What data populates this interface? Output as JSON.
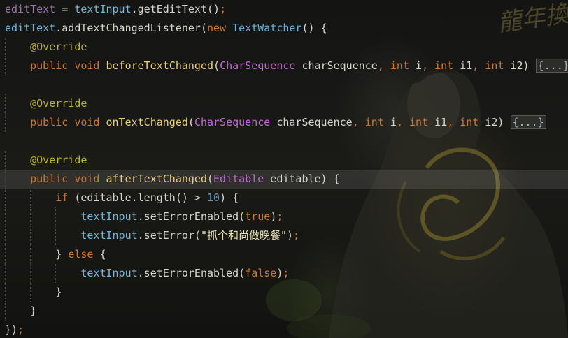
{
  "editor": {
    "lines": [
      {
        "tokens": [
          {
            "t": "editText",
            "c": "field"
          },
          {
            "t": " = ",
            "c": "plain"
          },
          {
            "t": "textInput",
            "c": "fieldcyan"
          },
          {
            "t": ".getEditText()",
            "c": "plain"
          },
          {
            "t": ";",
            "c": "semi"
          }
        ]
      },
      {
        "tokens": [
          {
            "t": "editText",
            "c": "fieldcyan"
          },
          {
            "t": ".addTextChangedListener(",
            "c": "plain"
          },
          {
            "t": "new",
            "c": "kw"
          },
          {
            "t": " ",
            "c": "plain"
          },
          {
            "t": "TextWatcher",
            "c": "cls"
          },
          {
            "t": "() {",
            "c": "plain"
          }
        ]
      },
      {
        "tokens": [
          {
            "t": "    ",
            "c": "plain"
          },
          {
            "t": "@Override",
            "c": "ann"
          }
        ]
      },
      {
        "tokens": [
          {
            "t": "    ",
            "c": "plain"
          },
          {
            "t": "public",
            "c": "kw"
          },
          {
            "t": " ",
            "c": "plain"
          },
          {
            "t": "void",
            "c": "kw"
          },
          {
            "t": " ",
            "c": "plain"
          },
          {
            "t": "beforeTextChanged",
            "c": "method"
          },
          {
            "t": "(",
            "c": "plain"
          },
          {
            "t": "CharSequence",
            "c": "type"
          },
          {
            "t": " charSequence",
            "c": "plain"
          },
          {
            "t": ", ",
            "c": "semi"
          },
          {
            "t": "int",
            "c": "kw"
          },
          {
            "t": " i",
            "c": "plain"
          },
          {
            "t": ", ",
            "c": "semi"
          },
          {
            "t": "int",
            "c": "kw"
          },
          {
            "t": " i1",
            "c": "plain"
          },
          {
            "t": ", ",
            "c": "semi"
          },
          {
            "t": "int",
            "c": "kw"
          },
          {
            "t": " i2) ",
            "c": "plain"
          },
          {
            "t": "{...}",
            "c": "fold"
          }
        ]
      },
      {
        "tokens": []
      },
      {
        "tokens": [
          {
            "t": "    ",
            "c": "plain"
          },
          {
            "t": "@Override",
            "c": "ann"
          }
        ]
      },
      {
        "tokens": [
          {
            "t": "    ",
            "c": "plain"
          },
          {
            "t": "public",
            "c": "kw"
          },
          {
            "t": " ",
            "c": "plain"
          },
          {
            "t": "void",
            "c": "kw"
          },
          {
            "t": " ",
            "c": "plain"
          },
          {
            "t": "onTextChanged",
            "c": "method"
          },
          {
            "t": "(",
            "c": "plain"
          },
          {
            "t": "CharSequence",
            "c": "type"
          },
          {
            "t": " charSequence",
            "c": "plain"
          },
          {
            "t": ", ",
            "c": "semi"
          },
          {
            "t": "int",
            "c": "kw"
          },
          {
            "t": " i",
            "c": "plain"
          },
          {
            "t": ", ",
            "c": "semi"
          },
          {
            "t": "int",
            "c": "kw"
          },
          {
            "t": " i1",
            "c": "plain"
          },
          {
            "t": ", ",
            "c": "semi"
          },
          {
            "t": "int",
            "c": "kw"
          },
          {
            "t": " i2) ",
            "c": "plain"
          },
          {
            "t": "{...}",
            "c": "fold"
          }
        ]
      },
      {
        "tokens": []
      },
      {
        "tokens": [
          {
            "t": "    ",
            "c": "plain"
          },
          {
            "t": "@Override",
            "c": "ann"
          }
        ]
      },
      {
        "current": true,
        "tokens": [
          {
            "t": "    ",
            "c": "plain"
          },
          {
            "t": "public",
            "c": "kw"
          },
          {
            "t": " ",
            "c": "plain"
          },
          {
            "t": "void",
            "c": "kw"
          },
          {
            "t": " ",
            "c": "plain"
          },
          {
            "t": "afterTextChanged",
            "c": "method"
          },
          {
            "t": "(",
            "c": "plain"
          },
          {
            "t": "Editable",
            "c": "type"
          },
          {
            "t": " editable) {",
            "c": "plain"
          }
        ]
      },
      {
        "tokens": [
          {
            "t": "        ",
            "c": "plain"
          },
          {
            "t": "if",
            "c": "kw"
          },
          {
            "t": " (editable.length() > ",
            "c": "plain"
          },
          {
            "t": "10",
            "c": "num"
          },
          {
            "t": ") {",
            "c": "plain"
          }
        ]
      },
      {
        "tokens": [
          {
            "t": "            ",
            "c": "plain"
          },
          {
            "t": "textInput",
            "c": "fieldcyan"
          },
          {
            "t": ".setErrorEnabled(",
            "c": "plain"
          },
          {
            "t": "true",
            "c": "kw"
          },
          {
            "t": ")",
            "c": "plain"
          },
          {
            "t": ";",
            "c": "semi"
          }
        ]
      },
      {
        "tokens": [
          {
            "t": "            ",
            "c": "plain"
          },
          {
            "t": "textInput",
            "c": "fieldcyan"
          },
          {
            "t": ".setError(",
            "c": "plain"
          },
          {
            "t": "\"抓个和尚做晚餐\"",
            "c": "str"
          },
          {
            "t": ")",
            "c": "plain"
          },
          {
            "t": ";",
            "c": "semi"
          }
        ]
      },
      {
        "tokens": [
          {
            "t": "        ",
            "c": "plain"
          },
          {
            "t": "} ",
            "c": "plain"
          },
          {
            "t": "else",
            "c": "kw"
          },
          {
            "t": " {",
            "c": "plain"
          }
        ]
      },
      {
        "tokens": [
          {
            "t": "            ",
            "c": "plain"
          },
          {
            "t": "textInput",
            "c": "fieldcyan"
          },
          {
            "t": ".setErrorEnabled(",
            "c": "plain"
          },
          {
            "t": "false",
            "c": "kw"
          },
          {
            "t": ")",
            "c": "plain"
          },
          {
            "t": ";",
            "c": "semi"
          }
        ]
      },
      {
        "tokens": [
          {
            "t": "        ",
            "c": "plain"
          },
          {
            "t": "}",
            "c": "plain"
          }
        ]
      },
      {
        "tokens": [
          {
            "t": "    ",
            "c": "plain"
          },
          {
            "t": "}",
            "c": "plain"
          }
        ]
      },
      {
        "tokens": [
          {
            "t": "})",
            "c": "plain"
          },
          {
            "t": ";",
            "c": "semi"
          }
        ]
      }
    ]
  },
  "colors": {
    "background": "#141413",
    "keyword": "#cc7832",
    "annotation": "#bbb529",
    "method": "#e8d27a",
    "type": "#c06ad0",
    "field": "#79b6d6",
    "number": "#6897bb"
  },
  "background_art": {
    "watermark_text": "龍年換"
  }
}
